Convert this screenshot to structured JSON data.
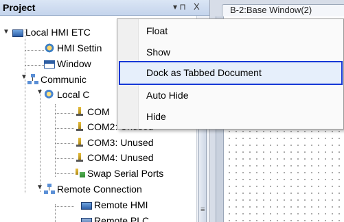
{
  "pane": {
    "title": "Project",
    "pin_icon": "pin-icon",
    "close_icon": "close-icon",
    "pin_glyph": "▾ ⊓",
    "close_glyph": "X"
  },
  "tree": {
    "root": "Local HMI ETC",
    "hmi_settings": "HMI Settin",
    "window": "Window",
    "communication": "Communic",
    "local_c": "Local C",
    "com1": "COM",
    "com2": "COM2: Unused",
    "com3": "COM3: Unused",
    "com4": "COM4: Unused",
    "swap": "Swap Serial Ports",
    "remote_connection": "Remote Connection",
    "remote_hmi": "Remote HMI",
    "remote_plc": "Remote PLC"
  },
  "document": {
    "tab_label": "B-2:Base Window(2)"
  },
  "menu": {
    "items": [
      {
        "label": "Float"
      },
      {
        "label": "Show"
      },
      {
        "label": "Dock as Tabbed Document"
      },
      {
        "label": "Auto Hide"
      },
      {
        "label": "Hide"
      }
    ],
    "highlighted_index": 2
  },
  "scrollbar": {
    "grip_glyph": "≡"
  }
}
